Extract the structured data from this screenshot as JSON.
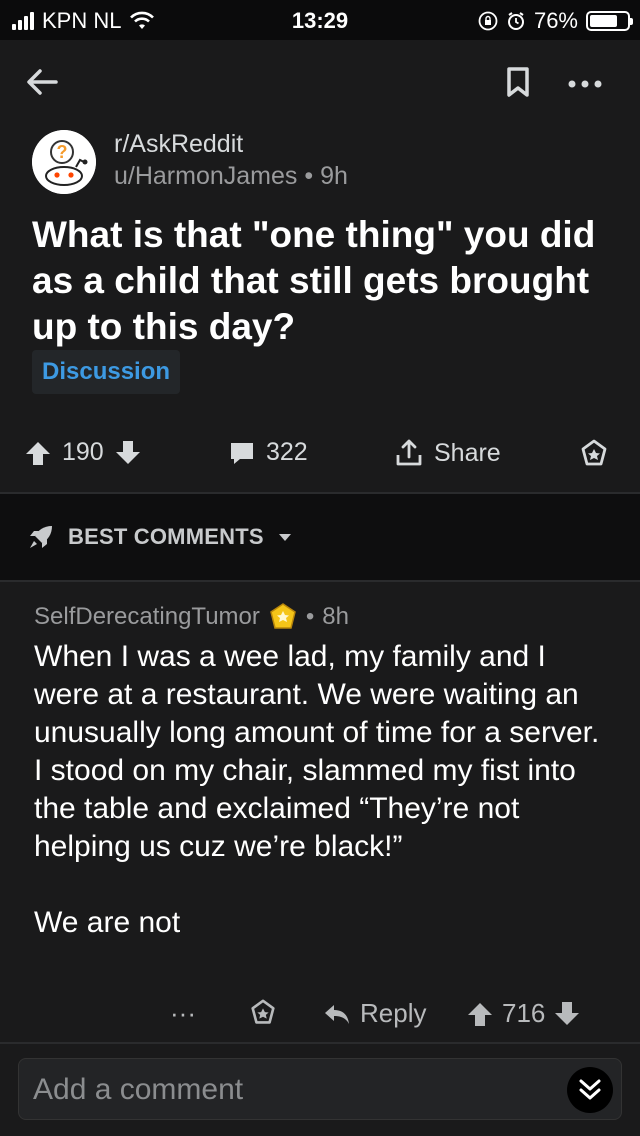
{
  "status_bar": {
    "carrier": "KPN NL",
    "time": "13:29",
    "battery": "76%",
    "battery_level": 0.76
  },
  "post": {
    "subreddit": "r/AskReddit",
    "author": "u/HarmonJames",
    "age": "9h",
    "title": "What is that \"one thing\" you did as a child that still gets brought up to this day?",
    "flair": "Discussion",
    "upvotes": "190",
    "comments": "322",
    "share_label": "Share"
  },
  "sort": {
    "label": "BEST COMMENTS"
  },
  "comment": {
    "author": "SelfDerecatingTumor",
    "age": "8h",
    "body": "When I was a wee lad, my family and I were at a restaurant. We were waiting an unusually long amount of time for a server. I stood on my chair, slammed my fist into the table and exclaimed “They’re not helping us cuz we’re black!”\n\nWe are not",
    "more": "···",
    "reply_label": "Reply",
    "score": "716"
  },
  "composer": {
    "placeholder": "Add a comment"
  },
  "colors": {
    "background": "#1a1a1b",
    "flair_text": "#3d9ae3",
    "award_gold": "#f5c518"
  }
}
